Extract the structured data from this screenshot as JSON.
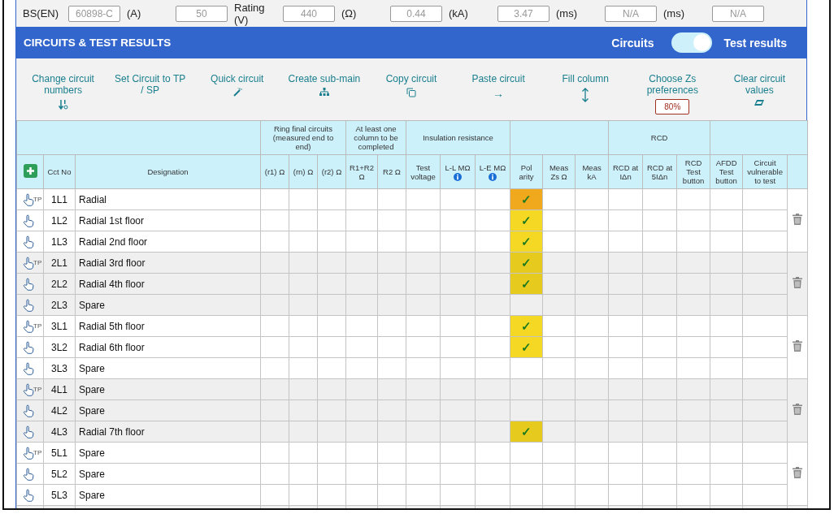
{
  "supply_fields": [
    {
      "label": "BS(EN)",
      "value": "60898-C"
    },
    {
      "label": "(A)",
      "value": "50"
    },
    {
      "label": "Rating (V)",
      "value": "440"
    },
    {
      "label": "(Ω)",
      "value": "0.44"
    },
    {
      "label": "(kA)",
      "value": "3.47"
    },
    {
      "label": "(ms)",
      "value": "N/A"
    },
    {
      "label": "(ms)",
      "value": "N/A"
    }
  ],
  "section": {
    "title": "CIRCUITS & TEST RESULTS",
    "toggle_left": "Circuits",
    "toggle_right": "Test results",
    "on": true
  },
  "toolbar": [
    {
      "label": "Change circuit numbers"
    },
    {
      "label": "Set Circuit to TP / SP"
    },
    {
      "label": "Quick circuit"
    },
    {
      "label": "Create sub-main"
    },
    {
      "label": "Copy circuit"
    },
    {
      "label": "Paste circuit",
      "symbol": "→"
    },
    {
      "label": "Fill column"
    },
    {
      "label": "Choose Zs preferences",
      "badge": "80%"
    },
    {
      "label": "Clear circuit values"
    }
  ],
  "header_groups": [
    {
      "label": "Ring final circuits (measured end to end)"
    },
    {
      "label": "At least one column to be completed"
    },
    {
      "label": "Insulation resistance"
    },
    {
      "label": "RCD"
    }
  ],
  "columns": [
    {
      "kind": "add"
    },
    {
      "label": "Cct No"
    },
    {
      "label": "Designation"
    },
    {
      "label": "(r1) Ω"
    },
    {
      "label": "(rn) Ω"
    },
    {
      "label": "(r2) Ω"
    },
    {
      "label": "R1+R2 Ω"
    },
    {
      "label": "R2 Ω"
    },
    {
      "label": "Test voltage"
    },
    {
      "label": "L-L MΩ",
      "info": true
    },
    {
      "label": "L-E MΩ",
      "info": true
    },
    {
      "label": "Pol arity"
    },
    {
      "label": "Meas Zs Ω"
    },
    {
      "label": "Meas kA"
    },
    {
      "label": "RCD at IΔn"
    },
    {
      "label": "RCD at 5IΔn"
    },
    {
      "label": "RCD Test button"
    },
    {
      "label": "AFDD Test button"
    },
    {
      "label": "Circuit vulnerable to test"
    },
    {
      "kind": "blank"
    }
  ],
  "groups": [
    {
      "rows": [
        {
          "cct": "1L1",
          "designation": "Radial",
          "badge": "TP",
          "polarity": {
            "mark": "✓",
            "color": "#f0a81c"
          }
        },
        {
          "cct": "1L2",
          "designation": "Radial 1st floor",
          "polarity": {
            "mark": "✓",
            "color": "#f5d823"
          }
        },
        {
          "cct": "1L3",
          "designation": "Radial 2nd floor",
          "polarity": {
            "mark": "✓",
            "color": "#f5d823"
          }
        }
      ]
    },
    {
      "rows": [
        {
          "cct": "2L1",
          "designation": "Radial 3rd floor",
          "badge": "TP",
          "polarity": {
            "mark": "✓",
            "color": "#e6cb1e"
          }
        },
        {
          "cct": "2L2",
          "designation": "Radial 4th floor",
          "polarity": {
            "mark": "✓",
            "color": "#e6cb1e"
          }
        },
        {
          "cct": "2L3",
          "designation": "Spare"
        }
      ]
    },
    {
      "rows": [
        {
          "cct": "3L1",
          "designation": "Radial 5th floor",
          "badge": "TP",
          "polarity": {
            "mark": "✓",
            "color": "#f5d823"
          }
        },
        {
          "cct": "3L2",
          "designation": "Radial 6th floor",
          "polarity": {
            "mark": "✓",
            "color": "#f5d823"
          }
        },
        {
          "cct": "3L3",
          "designation": "Spare"
        }
      ]
    },
    {
      "rows": [
        {
          "cct": "4L1",
          "designation": "Spare",
          "badge": "TP"
        },
        {
          "cct": "4L2",
          "designation": "Spare"
        },
        {
          "cct": "4L3",
          "designation": "Radial 7th floor",
          "polarity": {
            "mark": "✓",
            "color": "#e6cb1e"
          }
        }
      ]
    },
    {
      "rows": [
        {
          "cct": "5L1",
          "designation": "Spare",
          "badge": "TP"
        },
        {
          "cct": "5L2",
          "designation": "Spare"
        },
        {
          "cct": "5L3",
          "designation": "Spare"
        }
      ]
    }
  ]
}
